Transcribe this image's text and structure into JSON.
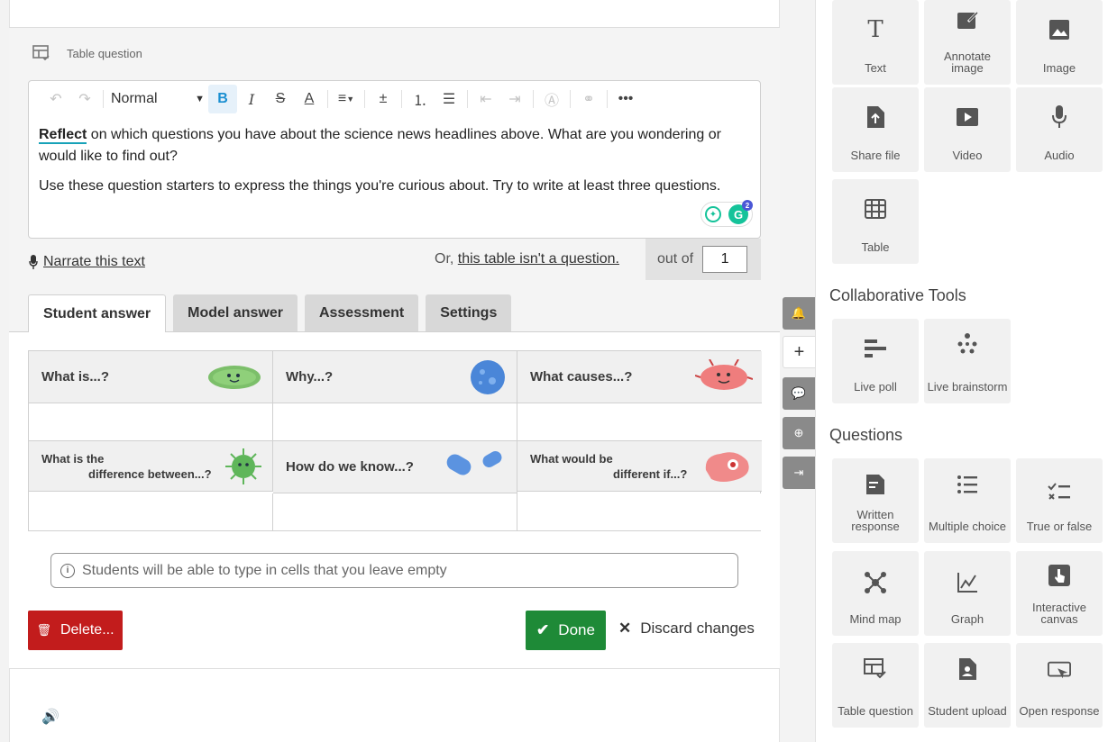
{
  "editor": {
    "question_type": "Table question",
    "toolbar": {
      "style_select": "Normal"
    },
    "content": {
      "p1_bold": "Reflect",
      "p1_rest": " on which questions you have about the science news headlines above. What are you wondering or would like to find out?",
      "p2": "Use these question starters to express the things you're curious about. Try to write at least three questions."
    },
    "grammarly_count": "2",
    "narrate_label": "Narrate this text",
    "or_prefix": "Or, ",
    "not_question_link": "this table isn't a question.",
    "out_of_label": "out of",
    "out_of_value": "1"
  },
  "tabs": [
    "Student answer",
    "Model answer",
    "Assessment",
    "Settings"
  ],
  "table": {
    "row1": [
      "What is...?",
      "Why...?",
      "What causes...?"
    ],
    "row2": [
      {
        "line1": "What is the",
        "line2": "difference between...?"
      },
      {
        "single": "How do we know...?"
      },
      {
        "line1": "What would be",
        "line2": "different if...?"
      }
    ]
  },
  "info_text": "Students will be able to type in cells that you leave empty",
  "buttons": {
    "delete": "Delete...",
    "done": "Done",
    "discard": "Discard changes"
  },
  "right_panel": {
    "content_tiles": [
      {
        "label": "Text",
        "icon": "text-icon"
      },
      {
        "label": "Annotate image",
        "icon": "annotate-icon"
      },
      {
        "label": "Image",
        "icon": "image-icon"
      },
      {
        "label": "Share file",
        "icon": "share-file-icon"
      },
      {
        "label": "Video",
        "icon": "video-icon"
      },
      {
        "label": "Audio",
        "icon": "microphone-icon"
      },
      {
        "label": "Table",
        "icon": "table-icon"
      }
    ],
    "collab_title": "Collaborative Tools",
    "collab_tiles": [
      {
        "label": "Live poll",
        "icon": "poll-icon"
      },
      {
        "label": "Live brainstorm",
        "icon": "brainstorm-icon"
      }
    ],
    "questions_title": "Questions",
    "question_tiles": [
      {
        "label": "Written response",
        "icon": "written-icon"
      },
      {
        "label": "Multiple choice",
        "icon": "list-icon"
      },
      {
        "label": "True or false",
        "icon": "true-false-icon"
      },
      {
        "label": "Mind map",
        "icon": "mind-map-icon"
      },
      {
        "label": "Graph",
        "icon": "graph-icon"
      },
      {
        "label": "Interactive canvas",
        "icon": "canvas-icon"
      },
      {
        "label": "Table question",
        "icon": "table-question-icon"
      },
      {
        "label": "Student upload",
        "icon": "upload-icon"
      },
      {
        "label": "Open response",
        "icon": "open-response-icon"
      }
    ]
  },
  "colors": {
    "delete": "#c21c1c",
    "done": "#1e8a37",
    "bold_active": "#1a8fd1"
  }
}
